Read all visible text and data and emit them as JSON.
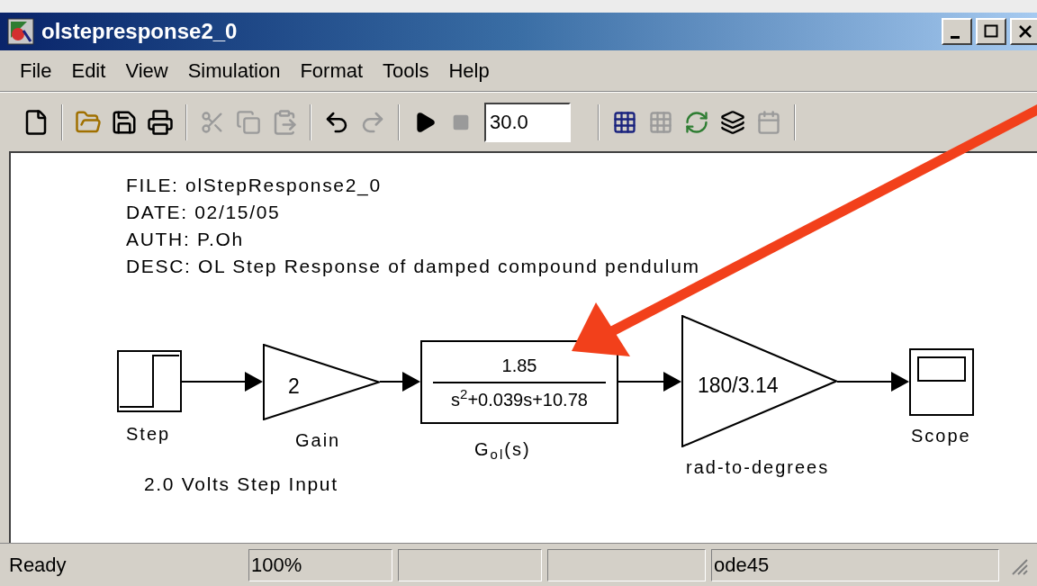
{
  "window": {
    "title": "olstepresponse2_0"
  },
  "menu": [
    "File",
    "Edit",
    "View",
    "Simulation",
    "Format",
    "Tools",
    "Help"
  ],
  "toolbar": {
    "stop_time": "30.0"
  },
  "diagram": {
    "notes": [
      "FILE: olStepResponse2_0",
      "DATE: 02/15/05",
      "AUTH: P.Oh",
      "DESC: OL Step Response of damped compound pendulum"
    ],
    "blocks": [
      {
        "kind": "step",
        "label": "Step"
      },
      {
        "kind": "gain",
        "value": "2",
        "label": "Gain"
      },
      {
        "kind": "transfer_function",
        "numerator": "1.85",
        "denominator": "s$^{2}$+0.039s+10.78",
        "label": "G$_{ol}$(s)"
      },
      {
        "kind": "gain",
        "value": "180/3.14",
        "label": "rad-to-degrees"
      },
      {
        "kind": "scope",
        "label": "Scope"
      }
    ],
    "annotation": "2.0 Volts Step Input"
  },
  "status_bar": {
    "message": "Ready",
    "zoom": "100%",
    "solver": "ode45"
  }
}
